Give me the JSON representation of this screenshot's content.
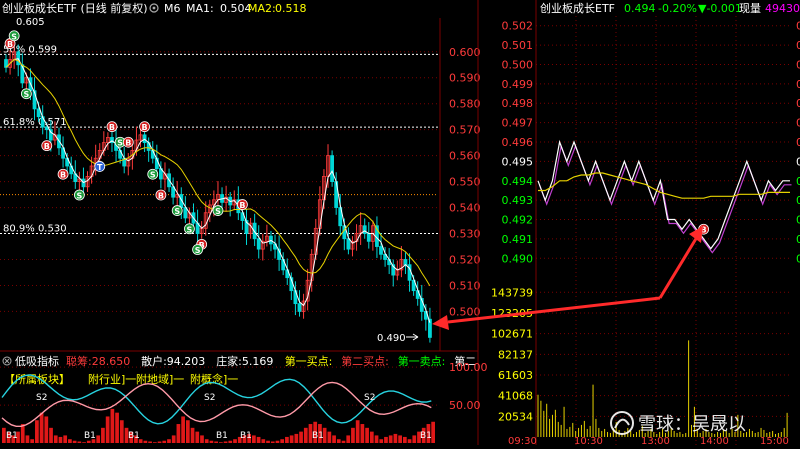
{
  "left_header": {
    "title": "创业板成长ETF (日线 前复权)",
    "ma_period": "M6",
    "ma1_label": "MA1:",
    "ma1_value": "0.504",
    "ma2_label": "MA2:",
    "ma2_value": "0.518"
  },
  "right_header": {
    "title": "创业板成长ETF",
    "price": "0.494",
    "change_pct": "-0.20%",
    "change": "▼-0.001",
    "volume_label": "现量",
    "volume": "49430"
  },
  "annotations": {
    "top_price": "0.605",
    "fib_50": "50% 0.599",
    "fib_618": "61.8% 0.571",
    "fib_809": "80.9% 0.530",
    "low_price": "0.490"
  },
  "indicator_header": {
    "name": "低吸指标",
    "items": [
      {
        "label": "聪筹:",
        "value": "28.650",
        "color": "#ff3b3b"
      },
      {
        "label": "散户:",
        "value": "94.203",
        "color": "#ffffff"
      },
      {
        "label": "庄家:",
        "value": "5.169",
        "color": "#ffffff"
      },
      {
        "label": "第一买点:",
        "value": "",
        "color": "#ffff00"
      },
      {
        "label": "第二买点:",
        "value": "",
        "color": "#ff3b3b"
      },
      {
        "label": "第一卖点:",
        "value": "",
        "color": "#00ff00"
      },
      {
        "label": "第二",
        "value": "",
        "color": "#ffffff"
      }
    ]
  },
  "indicator_tags": [
    "【所属板块】",
    "附行业]一",
    "附地域]一",
    "附概念]一"
  ],
  "watermark": "雪球：吴晟以",
  "colors": {
    "up": "#ff3b3b",
    "down": "#00d7d7",
    "ma1": "#ffffff",
    "ma2": "#e6d200",
    "grid": "#7a0000",
    "axis_label": "#ff3b3b"
  },
  "chart_data": [
    {
      "type": "candlestick",
      "title": "创业板成长ETF (日线 前复权)",
      "y_axis_ticks": [
        0.6,
        0.59,
        0.58,
        0.57,
        0.56,
        0.55,
        0.54,
        0.53,
        0.52,
        0.51,
        0.5
      ],
      "y_range": [
        0.489,
        0.613
      ],
      "fib_levels": [
        0.599,
        0.571,
        0.53
      ],
      "close": [
        0.594,
        0.597,
        0.6,
        0.595,
        0.588,
        0.59,
        0.585,
        0.578,
        0.575,
        0.571,
        0.57,
        0.566,
        0.568,
        0.563,
        0.559,
        0.556,
        0.553,
        0.55,
        0.551,
        0.548,
        0.552,
        0.556,
        0.559,
        0.562,
        0.565,
        0.567,
        0.565,
        0.562,
        0.559,
        0.556,
        0.559,
        0.562,
        0.566,
        0.568,
        0.565,
        0.562,
        0.559,
        0.555,
        0.551,
        0.553,
        0.548,
        0.544,
        0.545,
        0.54,
        0.536,
        0.538,
        0.534,
        0.53,
        0.532,
        0.538,
        0.541,
        0.543,
        0.545,
        0.542,
        0.544,
        0.541,
        0.543,
        0.538,
        0.535,
        0.53,
        0.534,
        0.528,
        0.524,
        0.527,
        0.529,
        0.526,
        0.524,
        0.52,
        0.516,
        0.513,
        0.508,
        0.503,
        0.5,
        0.504,
        0.512,
        0.522,
        0.532,
        0.543,
        0.552,
        0.56,
        0.55,
        0.54,
        0.533,
        0.528,
        0.524,
        0.527,
        0.53,
        0.533,
        0.53,
        0.527,
        0.533,
        0.525,
        0.522,
        0.52,
        0.518,
        0.514,
        0.516,
        0.52,
        0.518,
        0.512,
        0.508,
        0.505,
        0.5,
        0.497,
        0.49
      ],
      "ma1": "white moving average line",
      "ma2": "yellow moving average line"
    },
    {
      "type": "line",
      "title": "创业板成长ETF",
      "y_axis_ticks": [
        0.502,
        0.501,
        0.5,
        0.499,
        0.498,
        0.497,
        0.496,
        0.495,
        0.494,
        0.493,
        0.492,
        0.491,
        0.49
      ],
      "y_range": [
        0.4895,
        0.5025
      ],
      "price": [
        0.494,
        0.493,
        0.494,
        0.496,
        0.495,
        0.496,
        0.495,
        0.494,
        0.495,
        0.494,
        0.493,
        0.494,
        0.495,
        0.494,
        0.495,
        0.494,
        0.493,
        0.494,
        0.492,
        0.492,
        0.4915,
        0.492,
        0.4915,
        0.491,
        0.4905,
        0.491,
        0.492,
        0.493,
        0.494,
        0.495,
        0.494,
        0.493,
        0.494,
        0.4935,
        0.494,
        0.494
      ],
      "avg_price": [
        0.4935,
        0.4935,
        0.4937,
        0.494,
        0.494,
        0.4942,
        0.4943,
        0.4943,
        0.4944,
        0.4944,
        0.4943,
        0.4942,
        0.4941,
        0.494,
        0.4939,
        0.4938,
        0.4936,
        0.4934,
        0.4933,
        0.4932,
        0.4931,
        0.4931,
        0.4931,
        0.4931,
        0.4932,
        0.4932,
        0.4932,
        0.4932,
        0.4933,
        0.4933,
        0.4933,
        0.4933,
        0.4934,
        0.4934,
        0.4934,
        0.4934
      ]
    },
    {
      "type": "bar",
      "title": "成交量",
      "y_axis_ticks": [
        "143739",
        "123205",
        "102671",
        "82137",
        "61603",
        "41068",
        "20534"
      ],
      "x_tick_labels": [
        "09:30",
        "10:30",
        "13:00",
        "14:00",
        "15:00"
      ],
      "values": [
        42000,
        36000,
        26000,
        33000,
        18000,
        22000,
        27000,
        15000,
        12000,
        30000,
        8000,
        10000,
        14000,
        6000,
        9000,
        12000,
        16000,
        8000,
        11000,
        52000,
        18000,
        9000,
        6000,
        8000,
        5000,
        4000,
        9000,
        15000,
        7000,
        4000,
        6000,
        9000,
        6000,
        3000,
        5000,
        7000,
        11000,
        4000,
        6000,
        8000,
        5000,
        3000,
        5000,
        8000,
        4000,
        6000,
        9000,
        6000,
        4000,
        5000,
        3000,
        4000,
        96000,
        12000,
        30000,
        8000,
        4000,
        6000,
        8000,
        5000,
        4000,
        3000,
        5000,
        4000,
        7000,
        6000,
        4000,
        8000,
        5000,
        22000,
        6000,
        4000,
        5000,
        8000,
        6000,
        4000,
        5000,
        9000,
        7000,
        4000,
        5000,
        6000,
        3000,
        4000,
        5000,
        9000,
        24000
      ]
    },
    {
      "type": "area",
      "title": "低吸指标",
      "y_axis_ticks": [
        100.0,
        50.0
      ],
      "series": [
        {
          "name": "聪筹",
          "values": [
            20,
            15,
            10,
            15,
            25,
            10,
            5,
            30,
            40,
            35,
            20,
            10,
            8,
            10,
            5,
            3,
            2,
            1,
            3,
            5,
            10,
            20,
            35,
            45,
            40,
            30,
            20,
            15,
            10,
            5,
            3,
            2,
            1,
            2,
            3,
            5,
            10,
            25,
            35,
            30,
            20,
            15,
            10,
            5,
            3,
            2,
            1,
            2,
            3,
            5,
            8,
            10,
            12,
            10,
            8,
            5,
            3,
            2,
            3,
            5,
            8,
            10,
            12,
            15,
            20,
            25,
            28,
            25,
            20,
            15,
            10,
            5,
            3,
            10,
            20,
            30,
            25,
            20,
            15,
            10,
            5,
            8,
            10,
            12,
            10,
            8,
            5,
            10,
            15,
            20,
            25,
            28
          ]
        },
        {
          "name": "散户",
          "values": []
        },
        {
          "name": "庄家",
          "values": []
        }
      ]
    }
  ]
}
